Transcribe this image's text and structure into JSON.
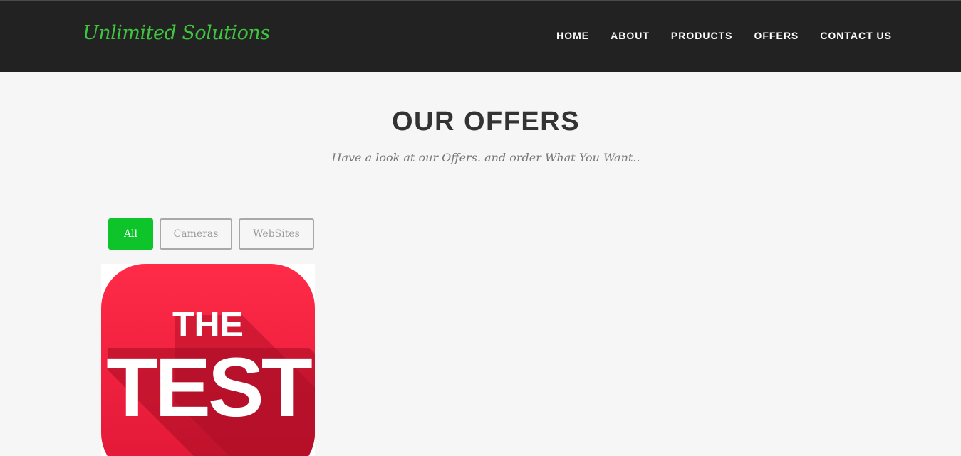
{
  "brand": {
    "name": "Unlimited Solutions",
    "color": "#3fc43f"
  },
  "nav": {
    "items": [
      "HOME",
      "ABOUT",
      "PRODUCTS",
      "OFFERS",
      "CONTACT US"
    ]
  },
  "offers": {
    "title": "OUR OFFERS",
    "subtitle": "Have a look at our Offers. and order What You Want.."
  },
  "filters": {
    "items": [
      "All",
      "Cameras",
      "WebSites"
    ],
    "active": "All",
    "active_color": "#0dc42a"
  },
  "portfolio": {
    "items": [
      {
        "image_text_line1": "THE",
        "image_text_line2": "TEST",
        "image_color": "#ff2845"
      }
    ]
  }
}
